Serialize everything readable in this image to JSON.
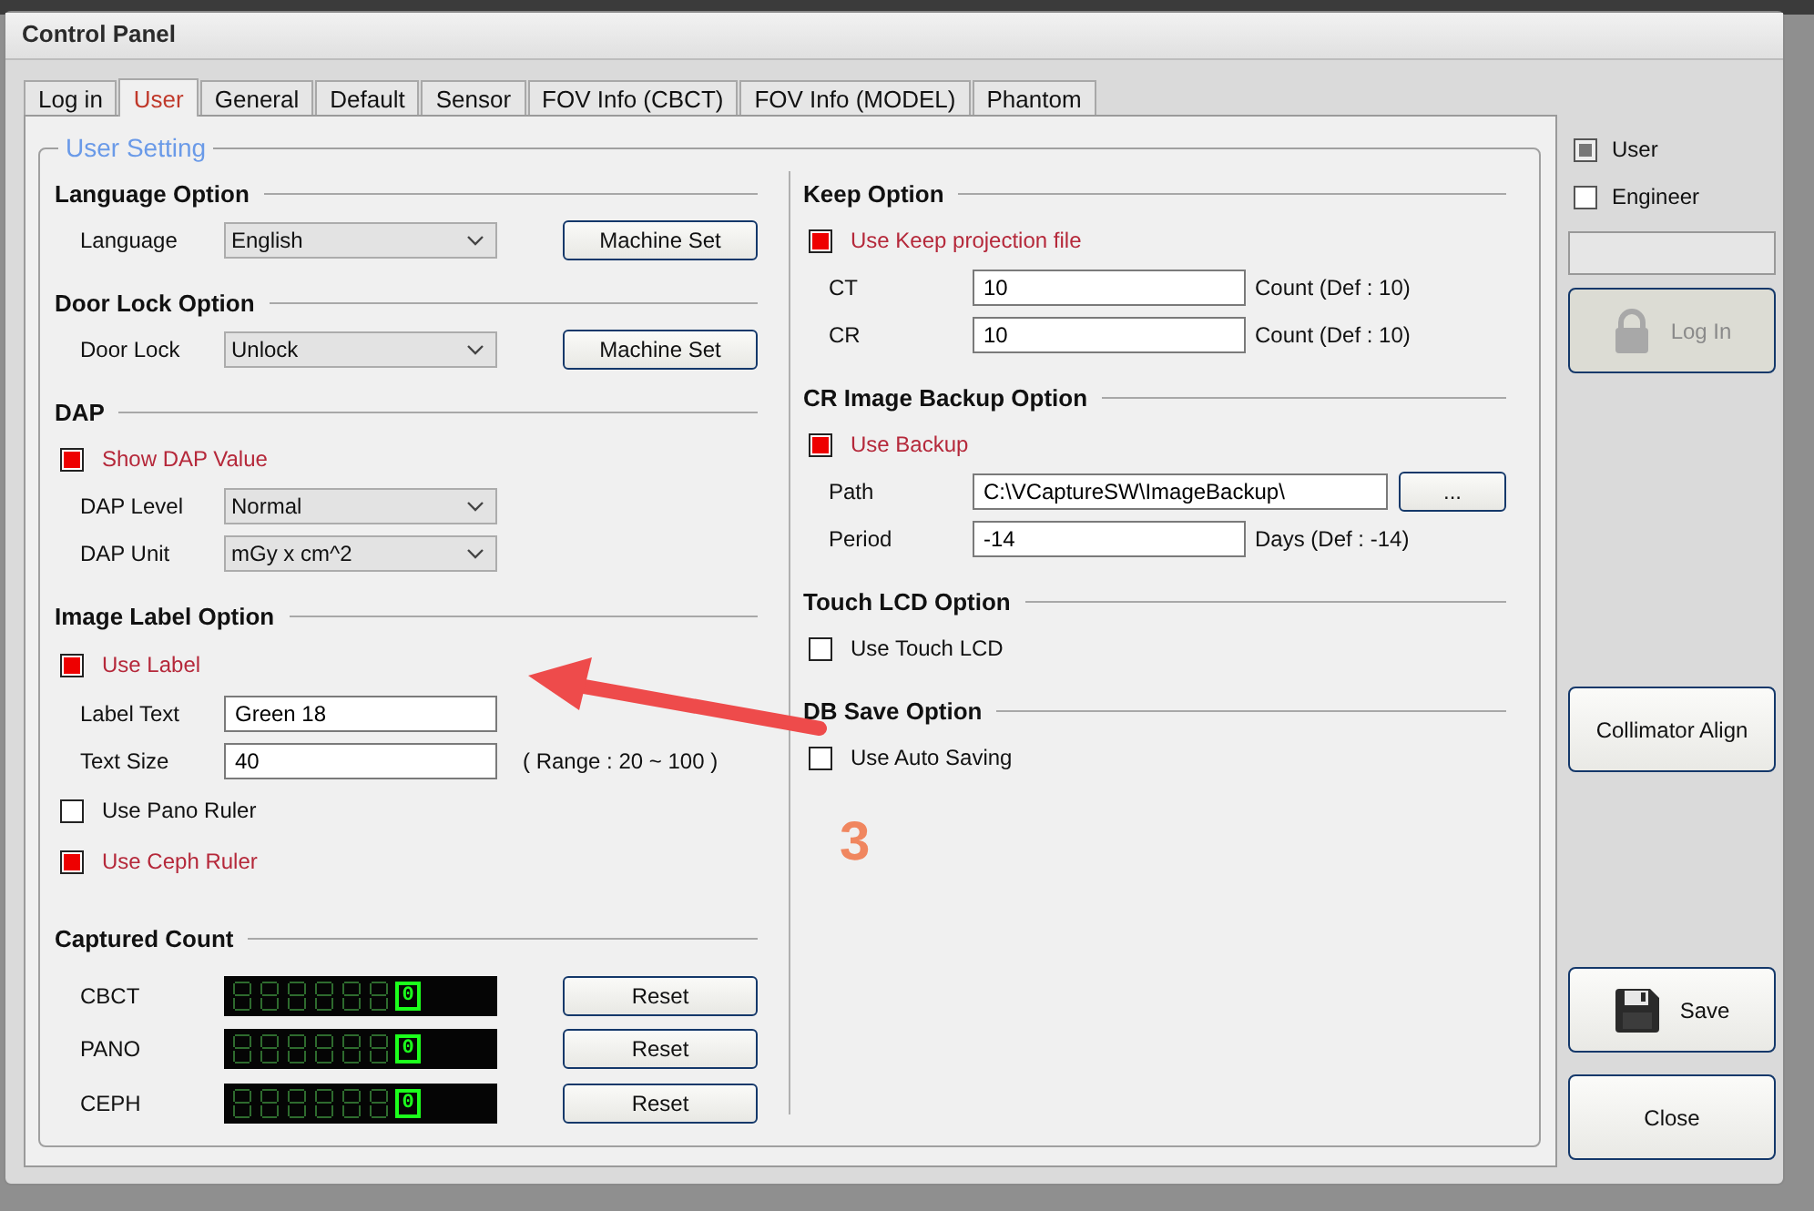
{
  "window": {
    "title": "Control Panel"
  },
  "tabs": [
    {
      "label": "Log in",
      "selected": false
    },
    {
      "label": "User",
      "selected": true
    },
    {
      "label": "General",
      "selected": false
    },
    {
      "label": "Default",
      "selected": false
    },
    {
      "label": "Sensor",
      "selected": false
    },
    {
      "label": "FOV Info (CBCT)",
      "selected": false
    },
    {
      "label": "FOV Info (MODEL)",
      "selected": false
    },
    {
      "label": "Phantom",
      "selected": false
    }
  ],
  "group_title": "User Setting",
  "left_sections": [
    {
      "title": "Language Option",
      "rows": [
        {
          "kind": "select",
          "label": "Language",
          "value": "English",
          "button": "Machine Set"
        }
      ]
    },
    {
      "title": "Door Lock Option",
      "rows": [
        {
          "kind": "select",
          "label": "Door Lock",
          "value": "Unlock",
          "button": "Machine Set"
        }
      ]
    },
    {
      "title": "DAP",
      "rows": [
        {
          "kind": "checkbox",
          "label": "Show DAP Value",
          "checked": true
        },
        {
          "kind": "select",
          "label": "DAP Level",
          "value": "Normal"
        },
        {
          "kind": "select",
          "label": "DAP Unit",
          "value": "mGy x cm^2"
        }
      ]
    },
    {
      "title": "Image Label Option",
      "rows": [
        {
          "kind": "checkbox",
          "label": "Use Label",
          "checked": true
        },
        {
          "kind": "input",
          "label": "Label Text",
          "value": "Green 18"
        },
        {
          "kind": "input",
          "label": "Text Size",
          "value": "40",
          "note": "( Range : 20 ~ 100 )"
        },
        {
          "kind": "checkbox",
          "label": "Use Pano Ruler",
          "checked": false
        },
        {
          "kind": "checkbox",
          "label": "Use Ceph Ruler",
          "checked": true
        }
      ]
    },
    {
      "title": "Captured Count",
      "rows": [
        {
          "kind": "counter",
          "label": "CBCT",
          "value": "0",
          "button": "Reset"
        },
        {
          "kind": "counter",
          "label": "PANO",
          "value": "0",
          "button": "Reset"
        },
        {
          "kind": "counter",
          "label": "CEPH",
          "value": "0",
          "button": "Reset"
        }
      ]
    }
  ],
  "right_sections": [
    {
      "title": "Keep Option",
      "rows": [
        {
          "kind": "checkbox",
          "label": "Use Keep projection file",
          "checked": true
        },
        {
          "kind": "input",
          "label": "CT",
          "value": "10",
          "note": "Count (Def : 10)"
        },
        {
          "kind": "input",
          "label": "CR",
          "value": "10",
          "note": "Count (Def : 10)"
        }
      ]
    },
    {
      "title": "CR Image Backup Option",
      "rows": [
        {
          "kind": "checkbox",
          "label": "Use Backup",
          "checked": true
        },
        {
          "kind": "input",
          "label": "Path",
          "value": "C:\\VCaptureSW\\ImageBackup\\",
          "button": "..."
        },
        {
          "kind": "input",
          "label": "Period",
          "value": "-14",
          "note": "Days (Def : -14)"
        }
      ]
    },
    {
      "title": "Touch LCD Option",
      "rows": [
        {
          "kind": "checkbox",
          "label": "Use Touch LCD",
          "checked": false
        }
      ]
    },
    {
      "title": "DB Save Option",
      "rows": [
        {
          "kind": "checkbox",
          "label": "Use Auto Saving",
          "checked": false
        }
      ]
    }
  ],
  "login": {
    "roles": [
      {
        "label": "User",
        "checked": true
      },
      {
        "label": "Engineer",
        "checked": false
      }
    ],
    "button": {
      "label": "Log In",
      "disabled": true
    }
  },
  "side_buttons": [
    {
      "kind": "plain",
      "label": "Collimator Align"
    },
    {
      "kind": "save",
      "label": "Save"
    },
    {
      "kind": "plain",
      "label": "Close"
    }
  ],
  "annotation": {
    "label": "3"
  }
}
